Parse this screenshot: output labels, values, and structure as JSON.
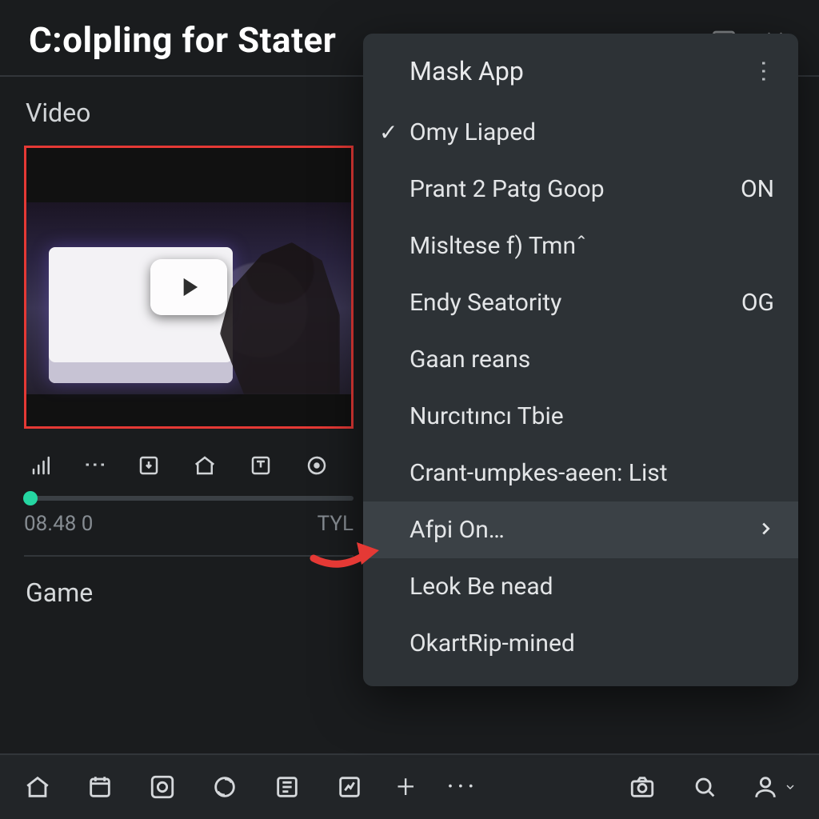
{
  "header": {
    "title": "C:olpling for Stater"
  },
  "sections": {
    "video_label": "Video",
    "game_label": "Game"
  },
  "player": {
    "time_left": "08.48 0",
    "time_right": "TYL"
  },
  "menu": {
    "title": "Mask App",
    "items": [
      {
        "label": "Omy Liaped",
        "checked": true
      },
      {
        "label": "Prant 2 Patg Goop",
        "value": "ON"
      },
      {
        "label": "Misltese f) Tmnˆ"
      },
      {
        "label": "Endy Seatority",
        "value": "OG"
      },
      {
        "label": "Gaan reans"
      },
      {
        "label": "Nurcıtıncı Tbie"
      },
      {
        "label": "Crant-umpkes-aeen: List"
      },
      {
        "label": "Afpi On…",
        "submenu": true,
        "highlight": true
      },
      {
        "label": "Leok Be nead"
      },
      {
        "label": "OkartRip-mined"
      }
    ]
  },
  "colors": {
    "accent_green": "#25d6a2",
    "highlight_red": "#e53935"
  }
}
